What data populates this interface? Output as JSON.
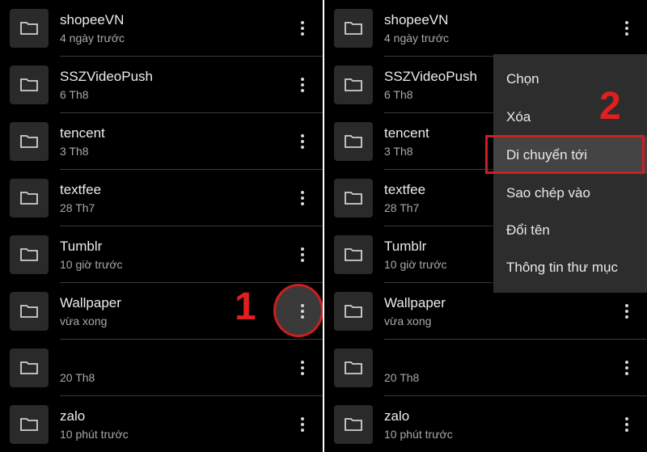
{
  "folders": [
    {
      "name": "shopeeVN",
      "sub": "4 ngày trước"
    },
    {
      "name": "SSZVideoPush",
      "sub": "6 Th8"
    },
    {
      "name": "tencent",
      "sub": "3 Th8"
    },
    {
      "name": "textfee",
      "sub": "28 Th7"
    },
    {
      "name": "Tumblr",
      "sub": "10 giờ trước"
    },
    {
      "name": "Wallpaper",
      "sub": "vừa xong"
    },
    {
      "name": "",
      "sub": "20 Th8"
    },
    {
      "name": "zalo",
      "sub": "10 phút trước"
    }
  ],
  "menu": {
    "items": [
      "Chọn",
      "Xóa",
      "Di chuyển tới",
      "Sao chép vào",
      "Đổi tên",
      "Thông tin thư mục"
    ],
    "highlighted_index": 2
  },
  "annotations": {
    "step1": "1",
    "step2": "2"
  },
  "colors": {
    "background": "#000000",
    "menu_bg": "#2d2d2d",
    "highlight_red": "#cc1f1f"
  },
  "icons": {
    "folder": "folder-icon",
    "more": "more-vertical-icon"
  }
}
